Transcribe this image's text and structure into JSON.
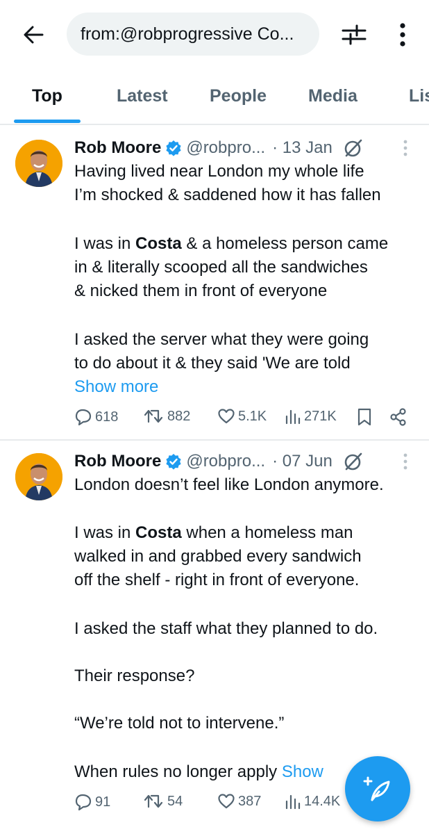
{
  "search": {
    "query": "from:@robprogressive Co..."
  },
  "tabs": [
    {
      "label": "Top",
      "active": true
    },
    {
      "label": "Latest",
      "active": false
    },
    {
      "label": "People",
      "active": false
    },
    {
      "label": "Media",
      "active": false
    },
    {
      "label": "Lis",
      "active": false
    }
  ],
  "tweets": [
    {
      "author": "Rob Moore",
      "handle": "@robpro...",
      "date": "· 13 Jan",
      "lines": [
        "Having lived near London my whole life",
        "I’m shocked & saddened how it has fallen",
        "",
        [
          "I was in ",
          "Costa",
          " & a homeless person came"
        ],
        "in & literally scooped all the sandwiches",
        "& nicked them in front of everyone",
        "",
        "I asked the server what they were going",
        "to do about it & they said 'We are told"
      ],
      "show_more": "Show more",
      "stats": {
        "replies": "618",
        "reposts": "882",
        "likes": "5.1K",
        "views": "271K"
      }
    },
    {
      "author": "Rob Moore",
      "handle": "@robpro...",
      "date": "· 07 Jun",
      "lines": [
        "London doesn’t feel like London anymore.",
        "",
        [
          "I was in ",
          "Costa",
          " when a homeless man"
        ],
        "walked in and grabbed every sandwich",
        "off the shelf - right in front of everyone.",
        "",
        "I asked the staff what they planned to do.",
        "",
        "Their response?",
        "",
        "“We’re told not to intervene.”",
        "",
        "When rules no longer apply "
      ],
      "show_more": "Show",
      "stats": {
        "replies": "91",
        "reposts": "54",
        "likes": "387",
        "views": "14.4K"
      }
    }
  ],
  "colors": {
    "accent": "#1d9bf0",
    "secondary_text": "#536471",
    "avatar_bg": "#f5a200"
  },
  "icons": [
    "back-arrow-icon",
    "filter-sliders-icon",
    "more-vertical-icon",
    "verified-badge-icon",
    "grok-icon",
    "reply-icon",
    "repost-icon",
    "like-icon",
    "views-icon",
    "bookmark-icon",
    "share-icon",
    "compose-icon"
  ]
}
